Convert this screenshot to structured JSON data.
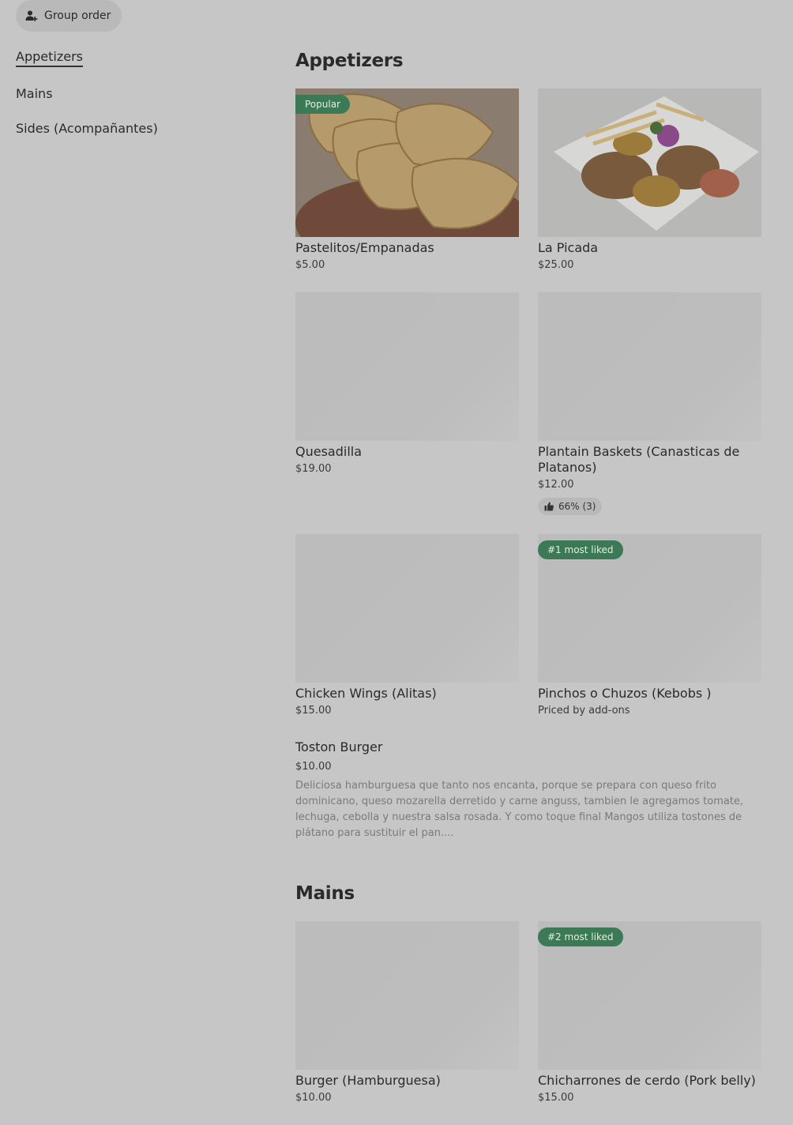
{
  "group_order": {
    "label": "Group order",
    "icon": "person-add-icon"
  },
  "sidebar": {
    "items": [
      {
        "label": "Appetizers",
        "active": true
      },
      {
        "label": "Mains",
        "active": false
      },
      {
        "label": "Sides (Acompañantes)",
        "active": false
      }
    ]
  },
  "sections": {
    "appetizers": {
      "title": "Appetizers",
      "items": [
        {
          "name": "Pastelitos/Empanadas",
          "price": "$5.00",
          "badge": "Popular",
          "image": "empanadas-photo"
        },
        {
          "name": "La Picada",
          "price": "$25.00",
          "image": "picada-photo"
        },
        {
          "name": "Quesadilla",
          "price": "$19.00"
        },
        {
          "name": "Plantain Baskets (Canasticas de Platanos)",
          "price": "$12.00",
          "rating": "66% (3)"
        },
        {
          "name": "Chicken Wings (Alitas)",
          "price": "$15.00"
        },
        {
          "name": "Pinchos o Chuzos (Kebobs )",
          "price": "Priced by add-ons",
          "badge": "#1 most liked"
        }
      ],
      "text_item": {
        "name": "Toston Burger",
        "price": "$10.00",
        "description": "Deliciosa hamburguesa que tanto nos encanta, porque se prepara con queso frito dominicano, queso mozarella derretido y carne anguss, tambien le agregamos tomate, lechuga, cebolla y nuestra salsa rosada. Y como toque final Mangos utiliza tostones de plátano para sustituir el pan...."
      }
    },
    "mains": {
      "title": "Mains",
      "items": [
        {
          "name": "Burger (Hamburguesa)",
          "price": "$10.00"
        },
        {
          "name": "Chicharrones de cerdo  (Pork belly)",
          "price": "$15.00",
          "badge": "#2 most liked"
        }
      ]
    }
  },
  "colors": {
    "background": "#c6c6c6",
    "badge": "#3c7a55",
    "placeholder": "#bcbcbc"
  }
}
